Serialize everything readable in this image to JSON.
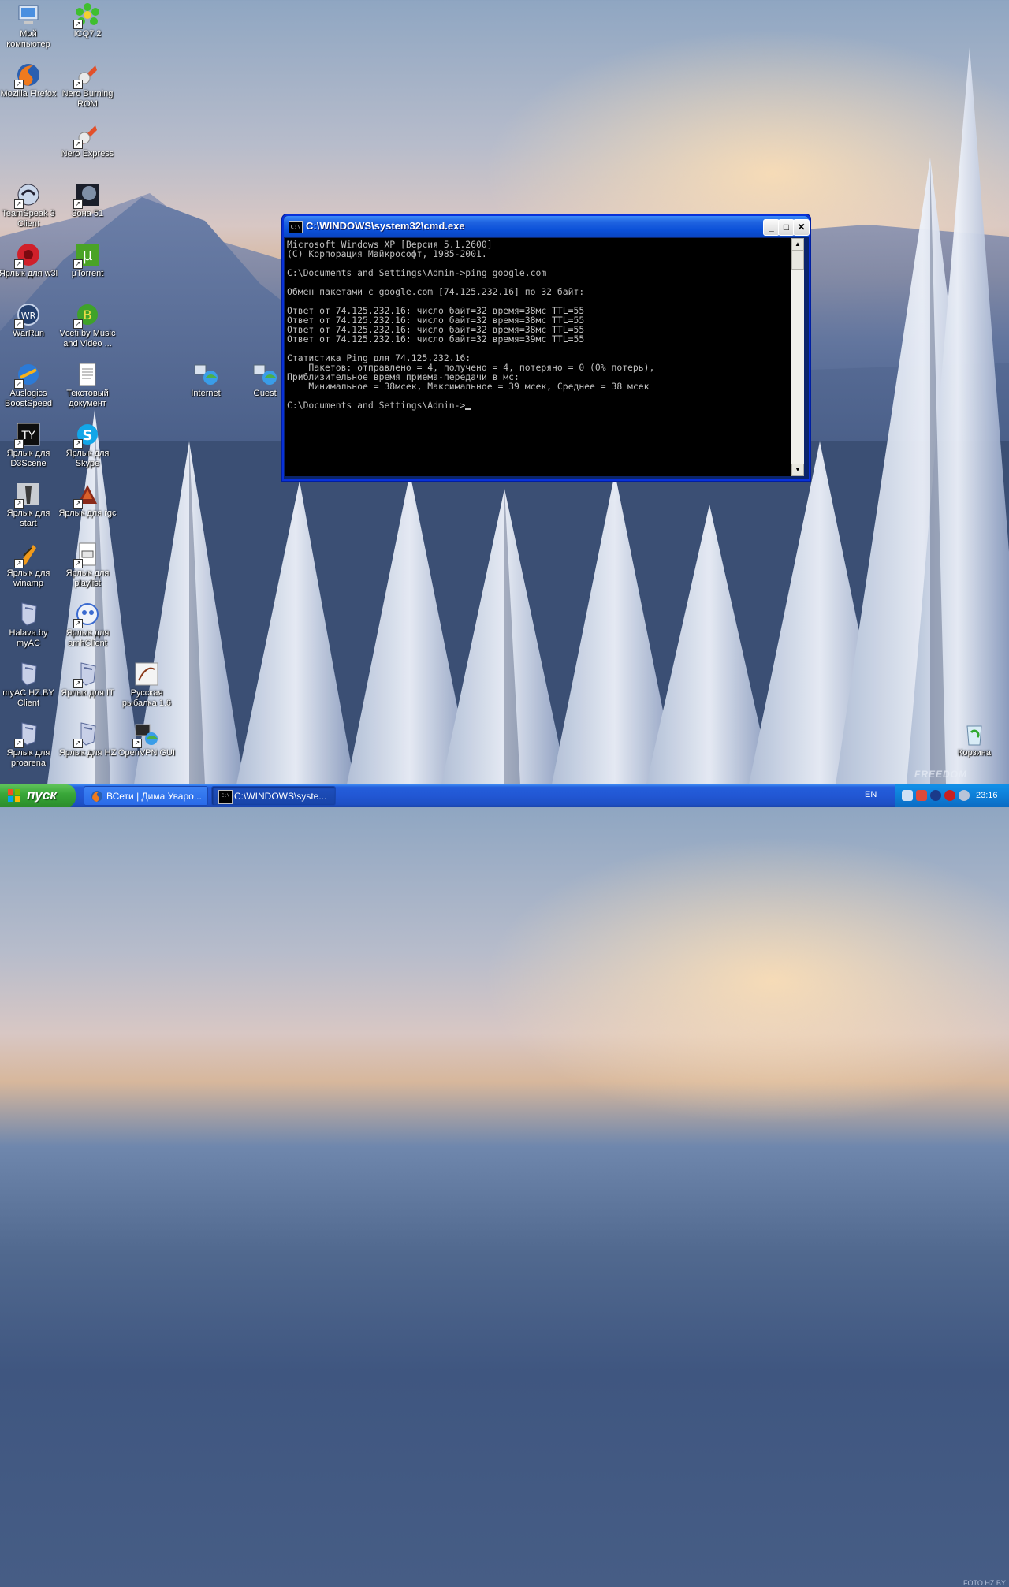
{
  "desktop": {
    "icons": [
      {
        "label": "Мой компьютер",
        "icon": "my-computer-icon"
      },
      {
        "label": "ICQ7.2",
        "icon": "icq-icon"
      },
      {
        "label": "Mozilla Firefox",
        "icon": "firefox-icon"
      },
      {
        "label": "Nero Burning ROM",
        "icon": "nero-icon"
      },
      {
        "label": "Nero Express",
        "icon": "nero-express-icon"
      },
      {
        "label": "TeamSpeak 3 Client",
        "icon": "teamspeak-icon"
      },
      {
        "label": "Зона 51",
        "icon": "zona51-icon"
      },
      {
        "label": "Ярлык для w3l",
        "icon": "w3l-icon"
      },
      {
        "label": "µTorrent",
        "icon": "utorrent-icon"
      },
      {
        "label": "WarRun",
        "icon": "warrun-icon"
      },
      {
        "label": "Vceti.by Music and Video ...",
        "icon": "vceti-icon"
      },
      {
        "label": "Auslogics BoostSpeed",
        "icon": "auslogics-icon"
      },
      {
        "label": "Текстовый документ",
        "icon": "text-document-icon"
      },
      {
        "label": "Internet",
        "icon": "network-internet-icon"
      },
      {
        "label": "Guest",
        "icon": "network-guest-icon"
      },
      {
        "label": "Ярлык для D3Scene",
        "icon": "d3scene-icon"
      },
      {
        "label": "Ярлык для Skype",
        "icon": "skype-icon"
      },
      {
        "label": "Ярлык для start",
        "icon": "counter-strike-icon"
      },
      {
        "label": "Ярлык для rgc",
        "icon": "rgc-icon"
      },
      {
        "label": "Ярлык для winamp",
        "icon": "winamp-icon"
      },
      {
        "label": "Ярлык для playlist",
        "icon": "playlist-icon"
      },
      {
        "label": "Halava.by myAC",
        "icon": "myac-shield-icon"
      },
      {
        "label": "Ярлык для amhClient",
        "icon": "amhclient-icon"
      },
      {
        "label": "myAC HZ.BY Client",
        "icon": "myac-shield-icon"
      },
      {
        "label": "Ярлык для IT",
        "icon": "myac-shield-icon"
      },
      {
        "label": "Русская рыбалка 1.6",
        "icon": "fishing-icon"
      },
      {
        "label": "Ярлык для proarena",
        "icon": "myac-shield-icon"
      },
      {
        "label": "Ярлык для HZ",
        "icon": "myac-shield-icon"
      },
      {
        "label": "OpenVPN GUI",
        "icon": "openvpn-icon"
      },
      {
        "label": "Корзина",
        "icon": "recycle-bin-icon"
      }
    ]
  },
  "console_window": {
    "title": "C:\\WINDOWS\\system32\\cmd.exe",
    "buttons": {
      "minimize": "_",
      "maximize": "□",
      "close": "✕"
    },
    "lines": [
      "Microsoft Windows XP [Версия 5.1.2600]",
      "(С) Корпорация Майкрософт, 1985-2001.",
      "",
      "C:\\Documents and Settings\\Admin->ping google.com",
      "",
      "Обмен пакетами с google.com [74.125.232.16] по 32 байт:",
      "",
      "Ответ от 74.125.232.16: число байт=32 время=38мс TTL=55",
      "Ответ от 74.125.232.16: число байт=32 время=38мс TTL=55",
      "Ответ от 74.125.232.16: число байт=32 время=38мс TTL=55",
      "Ответ от 74.125.232.16: число байт=32 время=39мс TTL=55",
      "",
      "Статистика Ping для 74.125.232.16:",
      "    Пакетов: отправлено = 4, получено = 4, потеряно = 0 (0% потерь),",
      "Приблизительное время приема-передачи в мс:",
      "    Минимальное = 38мсек, Максимальное = 39 мсек, Среднее = 38 мсек",
      ""
    ],
    "prompt": "C:\\Documents and Settings\\Admin->"
  },
  "taskbar": {
    "start_label": "пуск",
    "tasks": [
      {
        "label": "ВСети | Дима Уваро...",
        "icon": "firefox-icon",
        "active": false
      },
      {
        "label": "C:\\WINDOWS\\syste...",
        "icon": "cmd-icon",
        "active": true
      }
    ],
    "language": "EN",
    "clock": "23:16"
  },
  "watermark": {
    "brand": "FREEDOM",
    "site": "FOTO.HZ.BY"
  },
  "colors": {
    "taskbar": "#245edb",
    "start": "#3aa83a",
    "titlebar": "#0b50d8",
    "console_bg": "#000000",
    "console_fg": "#c0c0c0"
  }
}
